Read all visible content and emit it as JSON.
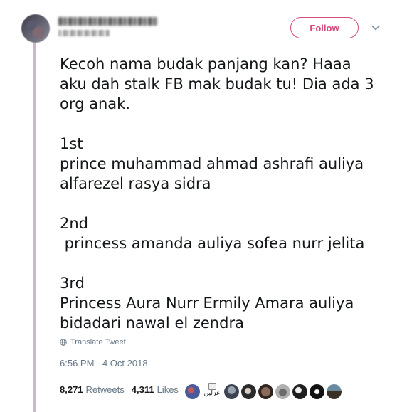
{
  "header": {
    "follow_label": "Follow"
  },
  "tweet": {
    "lines": [
      "Kecoh nama budak panjang kan? Haaa",
      "aku dah stalk FB mak budak tu! Dia ada 3",
      "org anak.",
      "1st",
      "prince muhammad ahmad ashrafi auliya",
      "alfarezel rasya sidra",
      "2nd",
      " princess amanda auliya sofea nurr jelita",
      "3rd",
      "Princess Aura Nurr Ermily Amara auliya",
      "bidadari nawal el zendra"
    ],
    "translate_label": "Translate Tweet",
    "timestamp": "6:56 PM - 4 Oct 2018"
  },
  "stats": {
    "retweets_count": "8,271",
    "retweets_label": "Retweets",
    "likes_count": "4,311",
    "likes_label": "Likes"
  },
  "likers": {
    "broken_image_alt": "عزلين"
  },
  "colors": {
    "accent": "#d44a7c",
    "muted_text": "#657786",
    "thread_line": "#c8b8c8"
  }
}
